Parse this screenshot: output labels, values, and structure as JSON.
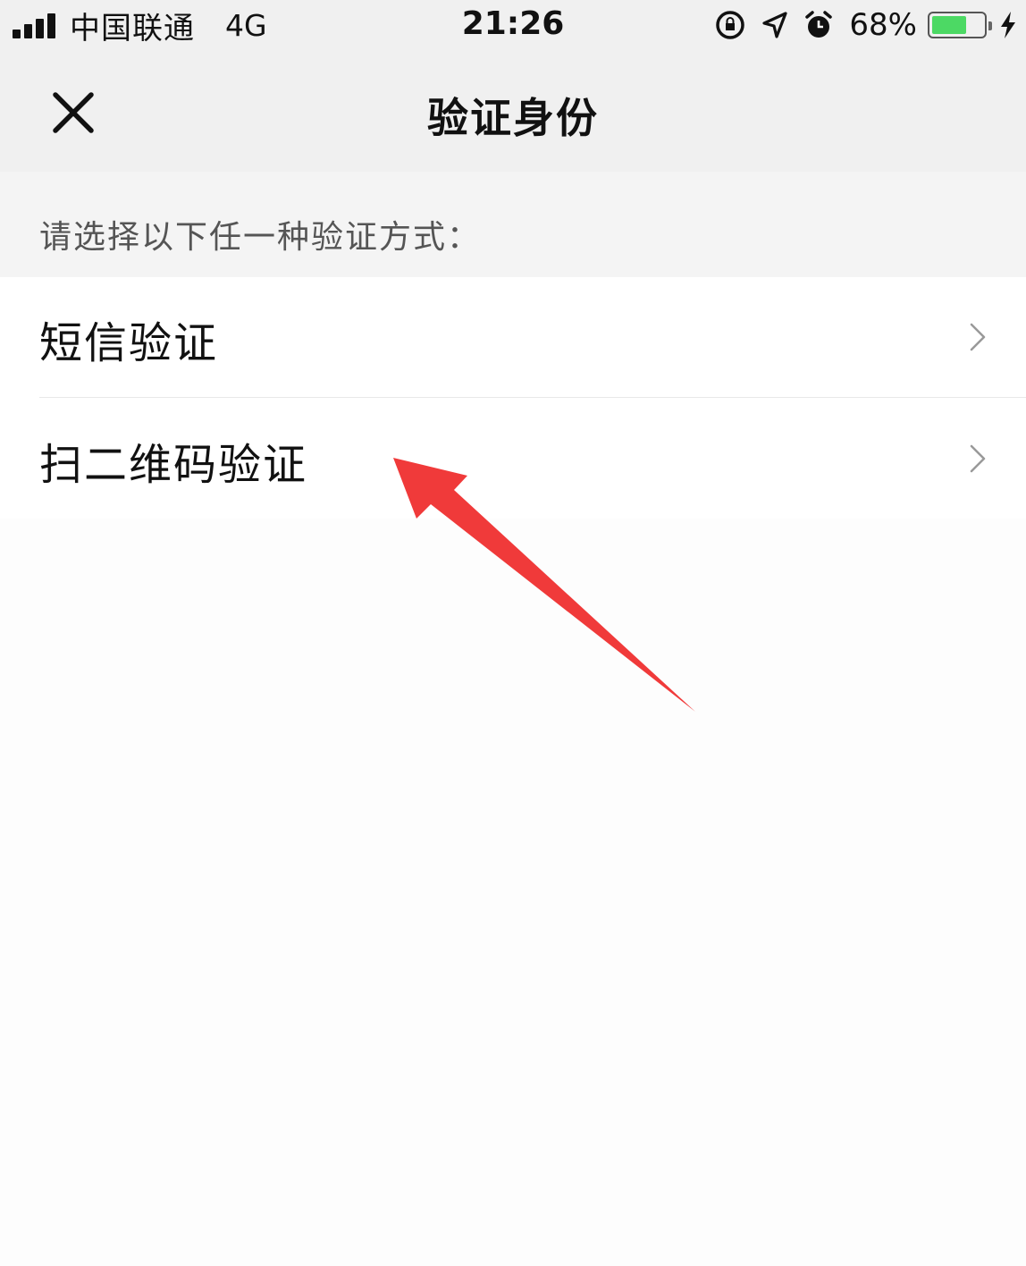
{
  "status_bar": {
    "carrier": "中国联通",
    "network": "4G",
    "time": "21:26",
    "battery_percent": "68%",
    "battery_level": 0.68,
    "battery_color": "#4cd964",
    "icons": [
      "signal-bars-icon",
      "screen-lock-icon",
      "location-icon",
      "alarm-icon",
      "battery-icon",
      "charging-bolt-icon"
    ]
  },
  "nav": {
    "title": "验证身份",
    "close_icon": "close-icon"
  },
  "hint": "请选择以下任一种验证方式：",
  "options": [
    {
      "label": "短信验证",
      "icon": "chevron-right-icon"
    },
    {
      "label": "扫二维码验证",
      "icon": "chevron-right-icon"
    }
  ],
  "annotation": {
    "color": "#f03a3a"
  }
}
